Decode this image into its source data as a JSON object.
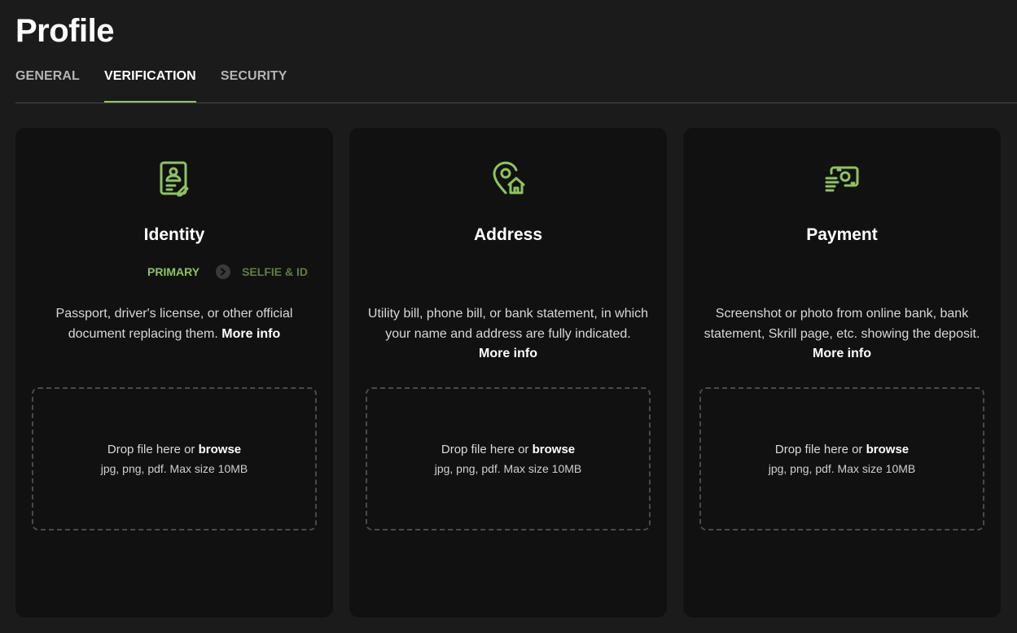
{
  "page": {
    "title": "Profile"
  },
  "tabs": [
    {
      "label": "GENERAL",
      "active": false
    },
    {
      "label": "VERIFICATION",
      "active": true
    },
    {
      "label": "SECURITY",
      "active": false
    }
  ],
  "colors": {
    "accent": "#8ec35f",
    "accent_dim": "#5e7f42",
    "background": "#1b1b1b",
    "card": "#111111"
  },
  "cards": [
    {
      "icon": "id-document-icon",
      "title": "Identity",
      "steps": {
        "primary": "PRIMARY",
        "secondary": "SELFIE & ID"
      },
      "description": "Passport, driver's license, or other official document replacing them.",
      "more_info": "More info",
      "drop_text": "Drop file here or",
      "browse": "browse",
      "hint": "jpg, png, pdf. Max size 10MB"
    },
    {
      "icon": "location-home-icon",
      "title": "Address",
      "description": "Utility bill, phone bill, or bank statement, in which your name and address are fully indicated.",
      "more_info": "More info",
      "drop_text": "Drop file here or",
      "browse": "browse",
      "hint": "jpg, png, pdf. Max size 10MB"
    },
    {
      "icon": "payment-money-icon",
      "title": "Payment",
      "description": "Screenshot or photo from online bank, bank statement, Skrill page, etc. showing the deposit.",
      "more_info": "More info",
      "drop_text": "Drop file here or",
      "browse": "browse",
      "hint": "jpg, png, pdf. Max size 10MB"
    }
  ]
}
